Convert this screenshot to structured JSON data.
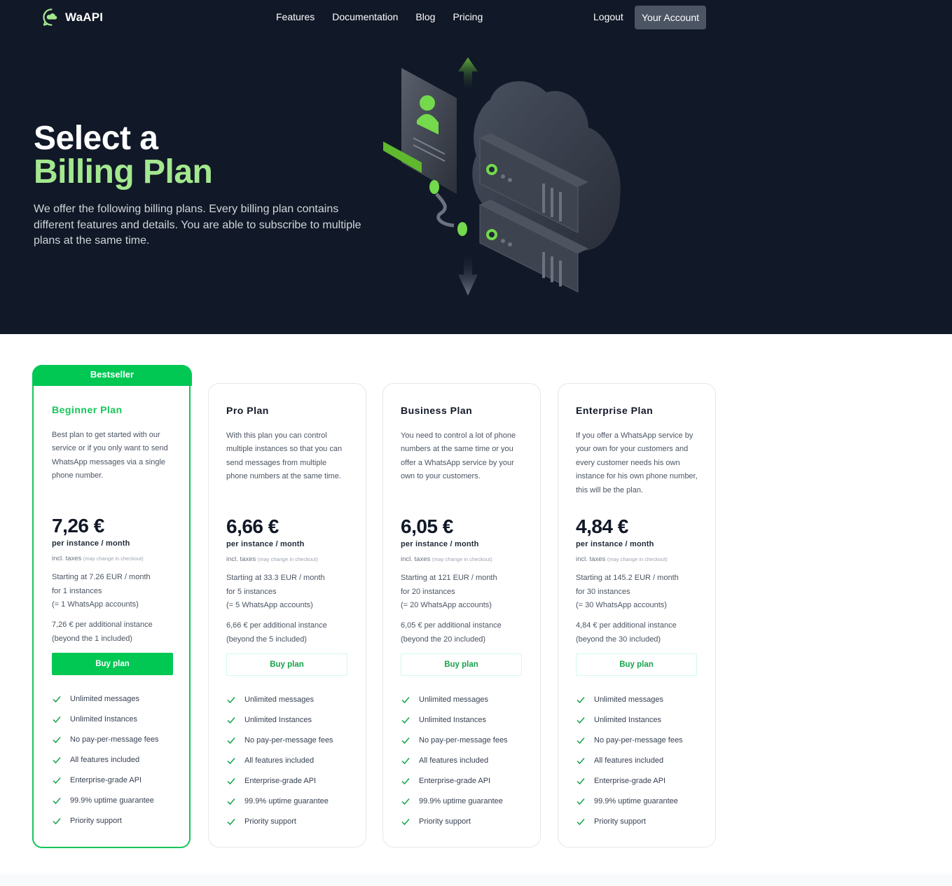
{
  "nav": {
    "brand": "WaAPI",
    "links": [
      "Features",
      "Documentation",
      "Blog",
      "Pricing"
    ],
    "logout": "Logout",
    "account": "Your Account"
  },
  "hero": {
    "title_line1": "Select a",
    "title_line2": "Billing Plan",
    "subtitle": "We offer the following billing plans. Every billing plan contains different features and details. You are able to subscribe to multiple plans at the same time."
  },
  "colors": {
    "hero_bg": "#111827",
    "accent_green": "#00c853",
    "title_green": "#a3e88f",
    "button_gray": "#4b5563"
  },
  "badge": "Bestseller",
  "plans": [
    {
      "name": "Beginner Plan",
      "description": "Best plan to get started with our service or if you only want to send WhatsApp messages via a single phone number.",
      "price": "7,26 €",
      "unit": "per instance / month",
      "taxes": "incl. taxes",
      "taxes_note": "(may change in checkout)",
      "starting_1": "Starting at 7.26 EUR / month",
      "starting_2": "for 1 instances",
      "starting_3": "(= 1 WhatsApp accounts)",
      "extra_1": "7,26 € per additional instance",
      "extra_2": "(beyond the 1 included)",
      "button": "Buy plan"
    },
    {
      "name": "Pro Plan",
      "description": "With this plan you can control multiple instances so that you can send messages from multiple phone numbers at the same time.",
      "price": "6,66 €",
      "unit": "per instance / month",
      "taxes": "incl. taxes",
      "taxes_note": "(may change in checkout)",
      "starting_1": "Starting at 33.3 EUR / month",
      "starting_2": "for 5 instances",
      "starting_3": "(= 5 WhatsApp accounts)",
      "extra_1": "6,66 € per additional instance",
      "extra_2": "(beyond the 5 included)",
      "button": "Buy plan"
    },
    {
      "name": "Business Plan",
      "description": "You need to control a lot of phone numbers at the same time or you offer a WhatsApp service by your own to your customers.",
      "price": "6,05 €",
      "unit": "per instance / month",
      "taxes": "incl. taxes",
      "taxes_note": "(may change in checkout)",
      "starting_1": "Starting at 121 EUR / month",
      "starting_2": "for 20 instances",
      "starting_3": "(= 20 WhatsApp accounts)",
      "extra_1": "6,05 € per additional instance",
      "extra_2": "(beyond the 20 included)",
      "button": "Buy plan"
    },
    {
      "name": "Enterprise Plan",
      "description": "If you offer a WhatsApp service by your own for your customers and every customer needs his own instance for his own phone number, this will be the plan.",
      "price": "4,84 €",
      "unit": "per instance / month",
      "taxes": "incl. taxes",
      "taxes_note": "(may change in checkout)",
      "starting_1": "Starting at 145.2 EUR / month",
      "starting_2": "for 30 instances",
      "starting_3": "(= 30 WhatsApp accounts)",
      "extra_1": "4,84 € per additional instance",
      "extra_2": "(beyond the 30 included)",
      "button": "Buy plan"
    }
  ],
  "features": [
    "Unlimited messages",
    "Unlimited Instances",
    "No pay-per-message fees",
    "All features included",
    "Enterprise-grade API",
    "99.9% uptime guarantee",
    "Priority support"
  ],
  "icons": {
    "logo": "chat-cloud-icon",
    "check": "check-icon"
  }
}
